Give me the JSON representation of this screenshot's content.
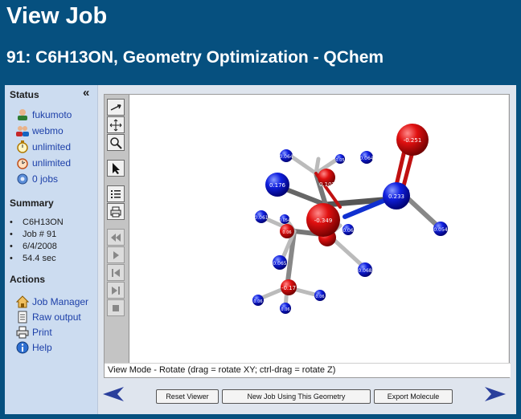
{
  "header": {
    "title": "View Job",
    "subtitle": "91: C6H13ON, Geometry Optimization - QChem"
  },
  "sidebar": {
    "collapse_glyph": "«",
    "status_heading": "Status",
    "status_items": [
      {
        "label": "fukumoto",
        "icon": "user-icon"
      },
      {
        "label": "webmo",
        "icon": "group-icon"
      },
      {
        "label": "unlimited",
        "icon": "timer-icon"
      },
      {
        "label": "unlimited",
        "icon": "clock-icon"
      },
      {
        "label": "0 jobs",
        "icon": "jobs-icon"
      }
    ],
    "summary_heading": "Summary",
    "summary_items": [
      "C6H13ON",
      "Job # 91",
      "6/4/2008",
      "54.4 sec"
    ],
    "actions_heading": "Actions",
    "action_items": [
      {
        "label": "Job Manager",
        "icon": "home-icon"
      },
      {
        "label": "Raw output",
        "icon": "document-icon"
      },
      {
        "label": "Print",
        "icon": "printer-icon"
      },
      {
        "label": "Help",
        "icon": "info-icon"
      }
    ]
  },
  "viewer": {
    "status_text": "View Mode - Rotate (drag = rotate XY; ctrl-drag = rotate Z)",
    "charges": {
      "O_top": "-0.251",
      "C_carbonyl": "0.233",
      "N": "-0.349",
      "C_left": "0.176",
      "C_mid": "0.107",
      "C_low": "-0.17",
      "H_a": "0.064",
      "H_b": "0.054",
      "H_c": "0.065",
      "H_d": "0.068",
      "H_e": "0.061",
      "H_f": "0.064",
      "H_g": "0.06",
      "H_h": "0.05",
      "H_i": "0.06",
      "H_j": "0.054",
      "H_k": "0.06",
      "H_l": "0.06",
      "H_m": "0.06"
    }
  },
  "buttons": {
    "reset": "Reset Viewer",
    "new_job": "New Job Using This Geometry",
    "export": "Export Molecule"
  },
  "colors": {
    "page_bg": "#06507f",
    "sidebar_bg": "#ccdcf0",
    "link": "#1c3fa8",
    "arrow": "#2a3f9c"
  }
}
